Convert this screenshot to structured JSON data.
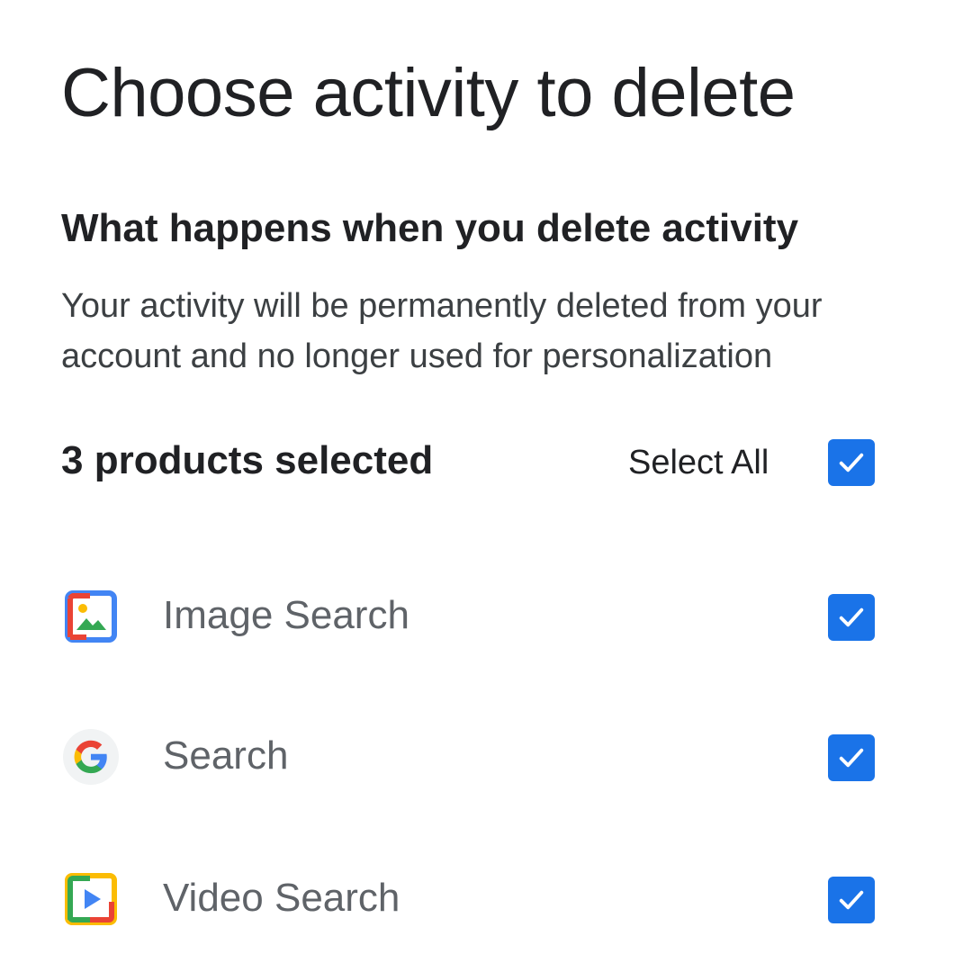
{
  "page": {
    "title": "Choose activity to delete"
  },
  "info": {
    "heading": "What happens when you delete activity",
    "body": "Your activity will be permanently deleted from your account and no longer used for personalization"
  },
  "selection": {
    "summary": "3 products selected",
    "select_all_label": "Select All",
    "select_all_checked": true
  },
  "products": [
    {
      "label": "Image Search",
      "icon": "image-search-icon",
      "checked": true
    },
    {
      "label": "Search",
      "icon": "google-g-icon",
      "checked": true
    },
    {
      "label": "Video Search",
      "icon": "video-search-icon",
      "checked": true
    }
  ],
  "colors": {
    "accent": "#1a73e8",
    "google_blue": "#4285F4",
    "google_red": "#EA4335",
    "google_yellow": "#FBBC04",
    "google_green": "#34A853"
  }
}
